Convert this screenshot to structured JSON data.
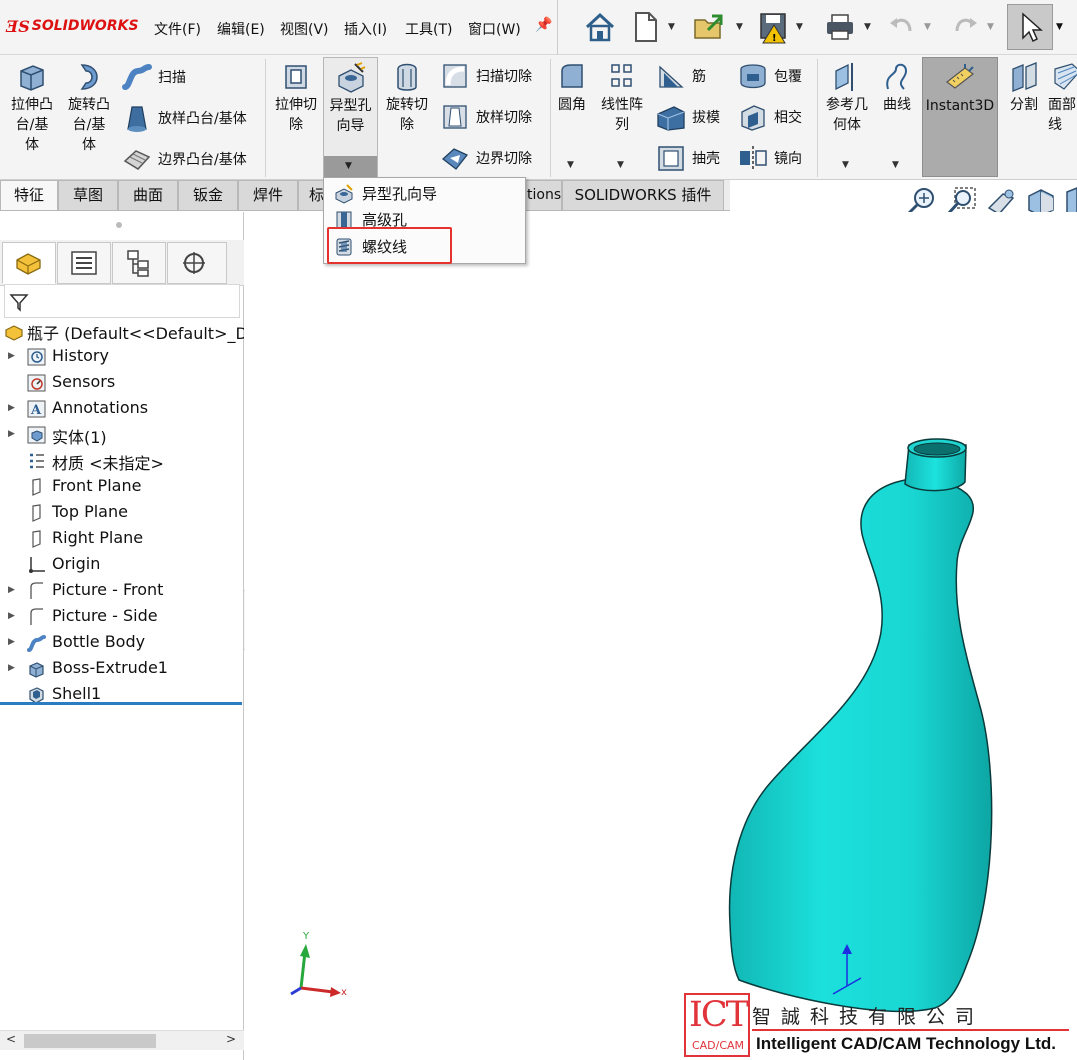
{
  "app": {
    "logo_text": "SOLIDWORKS",
    "accent_color": "#d11111"
  },
  "menu": {
    "items": [
      "文件(F)",
      "编辑(E)",
      "视图(V)",
      "插入(I)",
      "工具(T)",
      "窗口(W)"
    ]
  },
  "quick_access": {
    "icons": [
      "home-icon",
      "new-document-icon",
      "open-icon",
      "save-icon",
      "print-icon",
      "undo-icon",
      "redo-icon",
      "select-arrow-icon"
    ]
  },
  "ribbon": {
    "extruded_boss": "拉伸凸\n台/基\n体",
    "revolved_boss": "旋转凸\n台/基\n体",
    "swept_boss": "扫描",
    "lofted_boss": "放样凸台/基体",
    "boundary_boss": "边界凸台/基体",
    "extruded_cut": "拉伸切\n除",
    "hole_wizard": "异型孔\n向导",
    "revolved_cut": "旋转切\n除",
    "swept_cut": "扫描切除",
    "lofted_cut": "放样切除",
    "boundary_cut": "边界切除",
    "fillet": "圆角",
    "linear_pattern": "线性阵\n列",
    "rib": "筋",
    "draft": "拔模",
    "shell": "抽壳",
    "wrap": "包覆",
    "intersect": "相交",
    "mirror": "镜向",
    "reference_geometry": "参考几\n何体",
    "curves": "曲线",
    "instant3d": "Instant3D",
    "split": "分割",
    "face_curves_partial": "面部\n线"
  },
  "tabs": {
    "items": [
      "特征",
      "草图",
      "曲面",
      "钣金",
      "焊件",
      "标"
    ],
    "hidden_partial": "tions",
    "addins": "SOLIDWORKS 插件",
    "active": "特征"
  },
  "dropdown": {
    "items": [
      "异型孔向导",
      "高级孔",
      "螺纹线"
    ],
    "highlighted": "螺纹线",
    "highlight_color": "#e4322e"
  },
  "feature_tree": {
    "root": "瓶子  (Default<<Default>_Di",
    "nodes": [
      {
        "label": "History",
        "icon": "history-icon",
        "expandable": true
      },
      {
        "label": "Sensors",
        "icon": "sensor-icon",
        "expandable": false
      },
      {
        "label": "Annotations",
        "icon": "annotations-icon",
        "expandable": true
      },
      {
        "label": "实体(1)",
        "icon": "solid-bodies-icon",
        "expandable": true
      },
      {
        "label": "材质 <未指定>",
        "icon": "material-icon",
        "expandable": false
      },
      {
        "label": "Front Plane",
        "icon": "plane-icon",
        "expandable": false
      },
      {
        "label": "Top Plane",
        "icon": "plane-icon",
        "expandable": false
      },
      {
        "label": "Right Plane",
        "icon": "plane-icon",
        "expandable": false
      },
      {
        "label": "Origin",
        "icon": "origin-icon",
        "expandable": false
      },
      {
        "label": "Picture - Front",
        "icon": "sketch-picture-icon",
        "expandable": true
      },
      {
        "label": "Picture - Side",
        "icon": "sketch-picture-icon",
        "expandable": true
      },
      {
        "label": "Bottle Body",
        "icon": "sweep-feature-icon",
        "expandable": true
      },
      {
        "label": "Boss-Extrude1",
        "icon": "extrude-feature-icon",
        "expandable": true
      },
      {
        "label": "Shell1",
        "icon": "shell-feature-icon",
        "expandable": false
      }
    ]
  },
  "model": {
    "body_color": "#19d6d2",
    "triad_labels": {
      "x": "x",
      "y": "Y"
    }
  },
  "watermark": {
    "logo_big": "ICT",
    "logo_small": "CAD/CAM",
    "company_cn": "智誠科技有限公司",
    "company_en": "Intelligent CAD/CAM Technology Ltd."
  }
}
